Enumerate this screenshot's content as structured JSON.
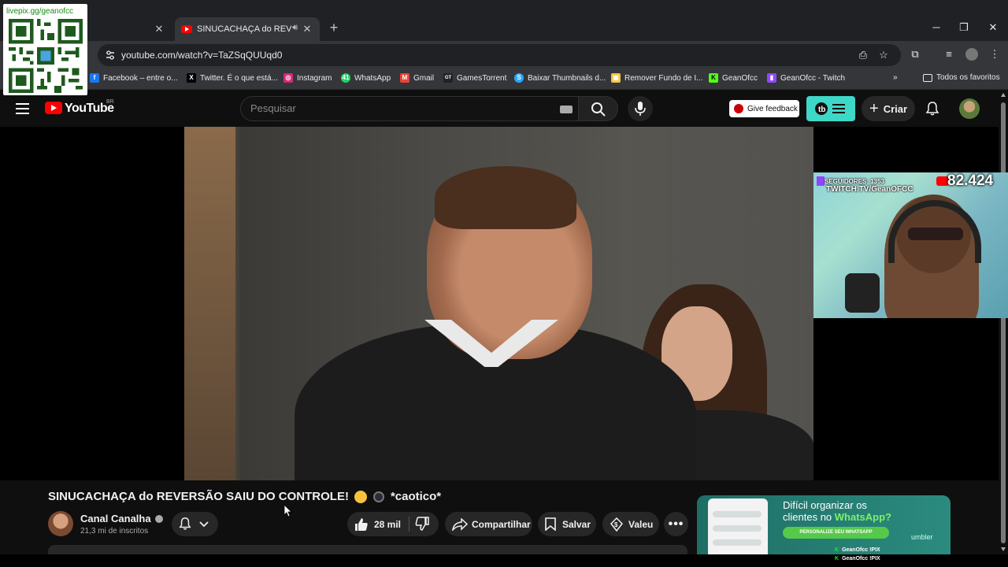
{
  "browser": {
    "tabs": [
      {
        "title": "",
        "active": false
      },
      {
        "title": "SINUCACHAÇA do REVERSÃ",
        "active": true
      }
    ],
    "url": "youtube.com/watch?v=TaZSqQUUqd0",
    "bookmarks": [
      {
        "label": "Facebook – entre o...",
        "icon_color": "#1877f2",
        "icon": "f"
      },
      {
        "label": "Twitter. É o que está...",
        "icon_color": "#000000",
        "icon": "X"
      },
      {
        "label": "Instagram",
        "icon_color": "#d62976",
        "icon": "◎"
      },
      {
        "label": "WhatsApp",
        "icon_color": "#25d366",
        "icon": "41"
      },
      {
        "label": "Gmail",
        "icon_color": "#ea4335",
        "icon": "M"
      },
      {
        "label": "GamesTorrent",
        "icon_color": "#222222",
        "icon": "GT"
      },
      {
        "label": "Baixar Thumbnails d...",
        "icon_color": "#2ea6ff",
        "icon": "S"
      },
      {
        "label": "Remover Fundo de I...",
        "icon_color": "#f5c542",
        "icon": "▣"
      },
      {
        "label": "GeanOfcc",
        "icon_color": "#53fc18",
        "icon": "K"
      },
      {
        "label": "GeanOfcc - Twitch",
        "icon_color": "#9146ff",
        "icon": "▮"
      }
    ],
    "all_bookmarks_label": "Todos os favoritos"
  },
  "qr_overlay": {
    "text": "livepix.gg/geanofcc"
  },
  "youtube": {
    "logo_text": "YouTube",
    "country_code": "BR",
    "search_placeholder": "Pesquisar",
    "feedback_label": "Give feedback",
    "create_label": "Criar"
  },
  "webcam": {
    "followers_text": "SEGUIDORES: 1353",
    "channel_text": "TWITCH.TV/GeanOFCC",
    "count": "82.424"
  },
  "video": {
    "title_part1": "SINUCACHAÇA do REVERSÃO SAIU DO CONTROLE!",
    "title_part2": "*caotico*",
    "channel_name": "Canal Canalha",
    "subscribers": "21,3 mi de inscritos",
    "likes": "28 mil",
    "share_label": "Compartilhar",
    "save_label": "Salvar",
    "thanks_label": "Valeu"
  },
  "ad": {
    "line1": "Difícil organizar os",
    "line2_prefix": "clientes no ",
    "line2_highlight": "WhatsApp?",
    "cta": "PERSONALIZE SEU WHATSAPP",
    "brand": "umbler"
  },
  "stream_overlay": {
    "lines": [
      {
        "name": "GeanOfcc",
        "tag": "!PIX"
      },
      {
        "name": "GeanOfcc",
        "tag": "!PIX"
      }
    ]
  }
}
